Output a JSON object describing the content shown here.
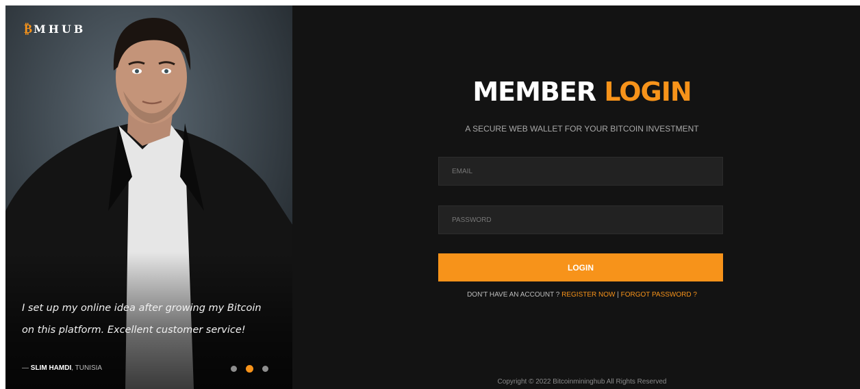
{
  "brand": {
    "logo_symbol": "₿",
    "logo_text": "MHUB",
    "accent_color": "#f7931a"
  },
  "testimonial": {
    "quote": "I set up my online idea after growing my Bitcoin on this platform. Excellent customer service!",
    "author_prefix": "— ",
    "author_name": "SLIM HAMDI",
    "author_location": ", TUNISIA",
    "slides": {
      "count": 3,
      "active": 2
    }
  },
  "login": {
    "title_main": "MEMBER",
    "title_accent": "LOGIN",
    "subtitle": "A SECURE WEB WALLET FOR YOUR BITCOIN INVESTMENT",
    "email_placeholder": "EMAIL",
    "password_placeholder": "PASSWORD",
    "button_label": "LOGIN",
    "no_account_text": "DON'T HAVE AN ACCOUNT ? ",
    "register_link": "REGISTER NOW",
    "separator": " | ",
    "forgot_link": "FORGOT PASSWORD ?"
  },
  "footer": {
    "copyright": "Copyright © 2022 Bitcoinmininghub All Rights Reserved"
  }
}
